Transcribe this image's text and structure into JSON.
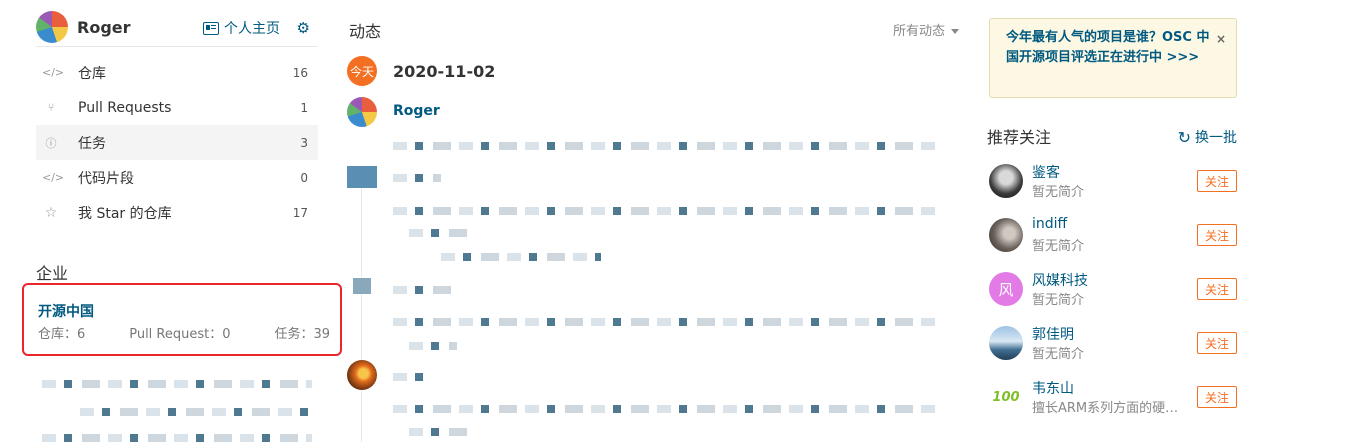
{
  "user": {
    "name": "Roger",
    "homepage_label": "个人主页"
  },
  "nav": [
    {
      "label": "仓库",
      "count": "16",
      "icon": "repo-icon"
    },
    {
      "label": "Pull Requests",
      "count": "1",
      "icon": "pull-request-icon"
    },
    {
      "label": "任务",
      "count": "3",
      "icon": "issue-icon"
    },
    {
      "label": "代码片段",
      "count": "0",
      "icon": "code-snippet-icon"
    },
    {
      "label": "我 Star 的仓库",
      "count": "17",
      "icon": "star-icon"
    }
  ],
  "enterprise": {
    "title": "企业",
    "name": "开源中国",
    "repos": "仓库：6",
    "pull_requests": "Pull Request：0",
    "tasks": "任务：39"
  },
  "feed": {
    "title": "动态",
    "filter": "所有动态",
    "today_badge": "今天",
    "date": "2020-11-02",
    "user": "Roger"
  },
  "notice": {
    "text": "今年最有人气的项目是谁？OSC 中国开源项目评选正在进行中 >>>",
    "close": "×"
  },
  "recommend": {
    "title": "推荐关注",
    "refresh_label": "换一批",
    "follow_label": "关注",
    "items": [
      {
        "name": "鉴客",
        "desc": "暂无简介"
      },
      {
        "name": "indiff",
        "desc": "暂无简介"
      },
      {
        "name": "风媒科技",
        "desc": "暂无简介",
        "avatar_text": "风"
      },
      {
        "name": "郭佳明",
        "desc": "暂无简介"
      },
      {
        "name": "韦东山",
        "desc": "擅长ARM系列方面的硬件开发",
        "avatar_text": "100"
      }
    ]
  },
  "colors": {
    "link": "#005980",
    "accent": "#f36f21",
    "highlight_border": "#e8262c"
  }
}
